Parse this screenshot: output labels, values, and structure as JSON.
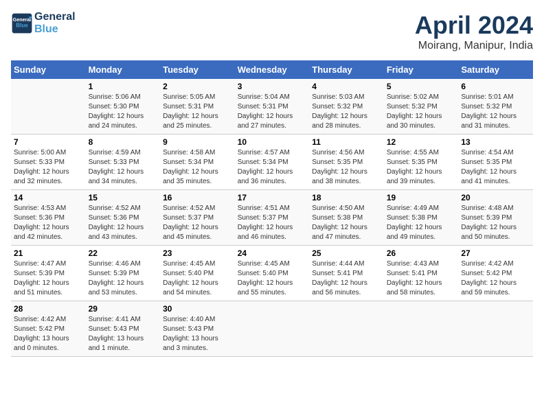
{
  "header": {
    "logo_line1": "General",
    "logo_line2": "Blue",
    "title": "April 2024",
    "subtitle": "Moirang, Manipur, India"
  },
  "days_of_week": [
    "Sunday",
    "Monday",
    "Tuesday",
    "Wednesday",
    "Thursday",
    "Friday",
    "Saturday"
  ],
  "weeks": [
    [
      {
        "num": "",
        "details": ""
      },
      {
        "num": "1",
        "details": "Sunrise: 5:06 AM\nSunset: 5:30 PM\nDaylight: 12 hours\nand 24 minutes."
      },
      {
        "num": "2",
        "details": "Sunrise: 5:05 AM\nSunset: 5:31 PM\nDaylight: 12 hours\nand 25 minutes."
      },
      {
        "num": "3",
        "details": "Sunrise: 5:04 AM\nSunset: 5:31 PM\nDaylight: 12 hours\nand 27 minutes."
      },
      {
        "num": "4",
        "details": "Sunrise: 5:03 AM\nSunset: 5:32 PM\nDaylight: 12 hours\nand 28 minutes."
      },
      {
        "num": "5",
        "details": "Sunrise: 5:02 AM\nSunset: 5:32 PM\nDaylight: 12 hours\nand 30 minutes."
      },
      {
        "num": "6",
        "details": "Sunrise: 5:01 AM\nSunset: 5:32 PM\nDaylight: 12 hours\nand 31 minutes."
      }
    ],
    [
      {
        "num": "7",
        "details": "Sunrise: 5:00 AM\nSunset: 5:33 PM\nDaylight: 12 hours\nand 32 minutes."
      },
      {
        "num": "8",
        "details": "Sunrise: 4:59 AM\nSunset: 5:33 PM\nDaylight: 12 hours\nand 34 minutes."
      },
      {
        "num": "9",
        "details": "Sunrise: 4:58 AM\nSunset: 5:34 PM\nDaylight: 12 hours\nand 35 minutes."
      },
      {
        "num": "10",
        "details": "Sunrise: 4:57 AM\nSunset: 5:34 PM\nDaylight: 12 hours\nand 36 minutes."
      },
      {
        "num": "11",
        "details": "Sunrise: 4:56 AM\nSunset: 5:35 PM\nDaylight: 12 hours\nand 38 minutes."
      },
      {
        "num": "12",
        "details": "Sunrise: 4:55 AM\nSunset: 5:35 PM\nDaylight: 12 hours\nand 39 minutes."
      },
      {
        "num": "13",
        "details": "Sunrise: 4:54 AM\nSunset: 5:35 PM\nDaylight: 12 hours\nand 41 minutes."
      }
    ],
    [
      {
        "num": "14",
        "details": "Sunrise: 4:53 AM\nSunset: 5:36 PM\nDaylight: 12 hours\nand 42 minutes."
      },
      {
        "num": "15",
        "details": "Sunrise: 4:52 AM\nSunset: 5:36 PM\nDaylight: 12 hours\nand 43 minutes."
      },
      {
        "num": "16",
        "details": "Sunrise: 4:52 AM\nSunset: 5:37 PM\nDaylight: 12 hours\nand 45 minutes."
      },
      {
        "num": "17",
        "details": "Sunrise: 4:51 AM\nSunset: 5:37 PM\nDaylight: 12 hours\nand 46 minutes."
      },
      {
        "num": "18",
        "details": "Sunrise: 4:50 AM\nSunset: 5:38 PM\nDaylight: 12 hours\nand 47 minutes."
      },
      {
        "num": "19",
        "details": "Sunrise: 4:49 AM\nSunset: 5:38 PM\nDaylight: 12 hours\nand 49 minutes."
      },
      {
        "num": "20",
        "details": "Sunrise: 4:48 AM\nSunset: 5:39 PM\nDaylight: 12 hours\nand 50 minutes."
      }
    ],
    [
      {
        "num": "21",
        "details": "Sunrise: 4:47 AM\nSunset: 5:39 PM\nDaylight: 12 hours\nand 51 minutes."
      },
      {
        "num": "22",
        "details": "Sunrise: 4:46 AM\nSunset: 5:39 PM\nDaylight: 12 hours\nand 53 minutes."
      },
      {
        "num": "23",
        "details": "Sunrise: 4:45 AM\nSunset: 5:40 PM\nDaylight: 12 hours\nand 54 minutes."
      },
      {
        "num": "24",
        "details": "Sunrise: 4:45 AM\nSunset: 5:40 PM\nDaylight: 12 hours\nand 55 minutes."
      },
      {
        "num": "25",
        "details": "Sunrise: 4:44 AM\nSunset: 5:41 PM\nDaylight: 12 hours\nand 56 minutes."
      },
      {
        "num": "26",
        "details": "Sunrise: 4:43 AM\nSunset: 5:41 PM\nDaylight: 12 hours\nand 58 minutes."
      },
      {
        "num": "27",
        "details": "Sunrise: 4:42 AM\nSunset: 5:42 PM\nDaylight: 12 hours\nand 59 minutes."
      }
    ],
    [
      {
        "num": "28",
        "details": "Sunrise: 4:42 AM\nSunset: 5:42 PM\nDaylight: 13 hours\nand 0 minutes."
      },
      {
        "num": "29",
        "details": "Sunrise: 4:41 AM\nSunset: 5:43 PM\nDaylight: 13 hours\nand 1 minute."
      },
      {
        "num": "30",
        "details": "Sunrise: 4:40 AM\nSunset: 5:43 PM\nDaylight: 13 hours\nand 3 minutes."
      },
      {
        "num": "",
        "details": ""
      },
      {
        "num": "",
        "details": ""
      },
      {
        "num": "",
        "details": ""
      },
      {
        "num": "",
        "details": ""
      }
    ]
  ]
}
